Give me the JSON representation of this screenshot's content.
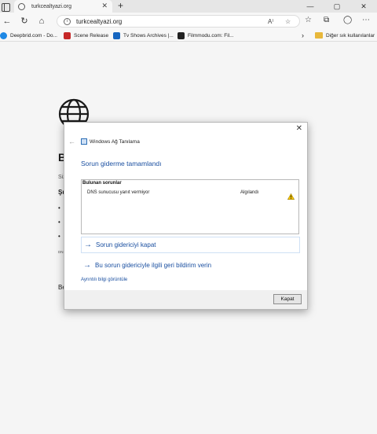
{
  "browser": {
    "tab": {
      "title": "turkcealtyazi.org",
      "close_glyph": "✕"
    },
    "new_tab_glyph": "+",
    "address": {
      "url": "turkcealtyazi.org"
    },
    "bookmarks": [
      {
        "label": "Deepbrid.com - Do...",
        "icon_color": "#1e88e5"
      },
      {
        "label": "Scene Release",
        "icon_color": "#c62828"
      },
      {
        "label": "Tv Shows Archives |...",
        "icon_color": "#1565c0"
      },
      {
        "label": "Filmmodu.com: Fil...",
        "icon_color": "#212121"
      }
    ],
    "bookmarks_folder": "Diğer sık kullanılanlar"
  },
  "page": {
    "heading": "B",
    "sub": "Siz",
    "h2": "Şu",
    "bullets": [
      "•",
      "•",
      "•"
    ],
    "code": "DNS",
    "tail": "Be"
  },
  "dialog": {
    "title": "Windows Ağ Tanılama",
    "heading": "Sorun giderme tamamlandı",
    "problems_header": "Bulunan sorunlar",
    "problem": {
      "name": "DNS sunucusu yanıt vermiyor",
      "status": "Algılandı"
    },
    "commands": [
      "Sorun gidericiyi kapat",
      "Bu sorun gidericiyle ilgili geri bildirim verin"
    ],
    "detail_link": "Ayrıntılı bilgi görüntüle",
    "close_button": "Kapat",
    "close_glyph": "✕"
  },
  "colors": {
    "accent": "#1a4fa0",
    "warning": "#f2c200"
  }
}
